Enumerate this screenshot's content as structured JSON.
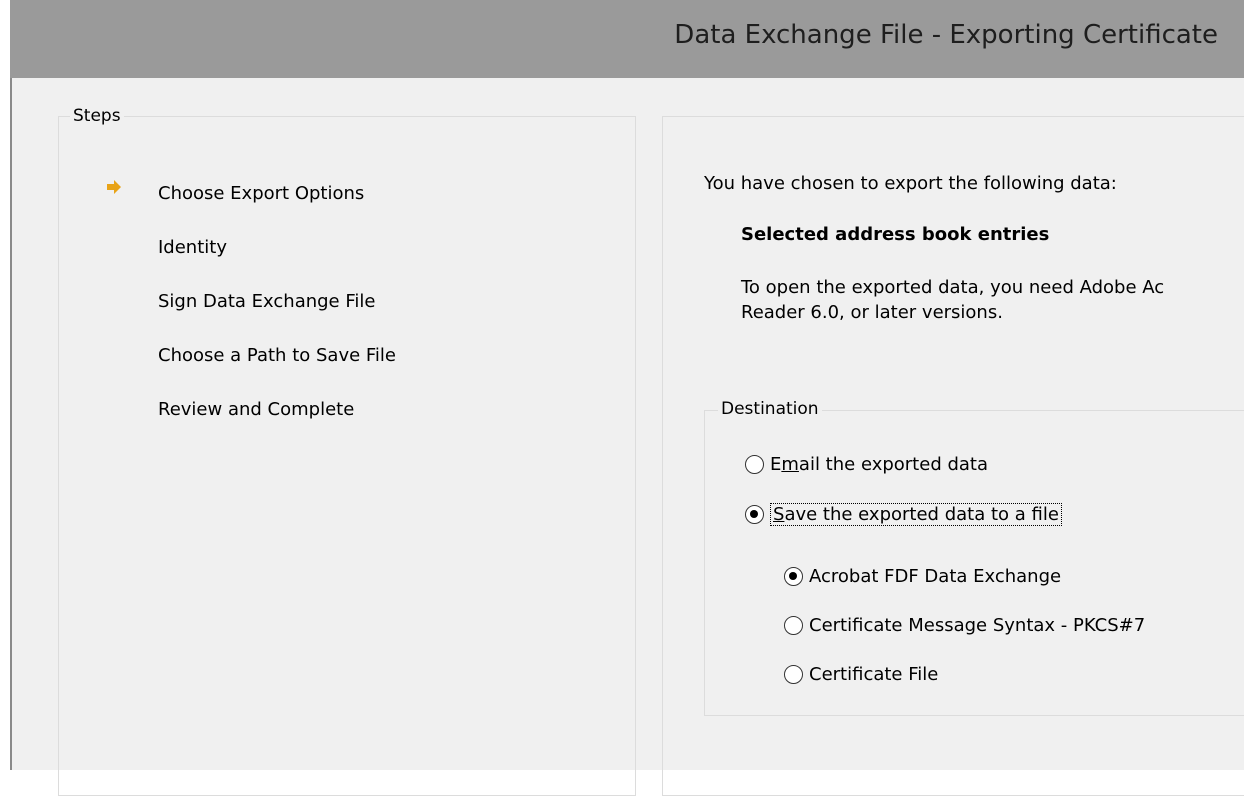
{
  "window": {
    "title": "Data Exchange File - Exporting Certificate"
  },
  "steps": {
    "group_label": "Steps",
    "items": [
      {
        "label": "Choose Export Options",
        "current": true
      },
      {
        "label": "Identity",
        "current": false
      },
      {
        "label": "Sign Data Exchange File",
        "current": false
      },
      {
        "label": "Choose a Path to Save File",
        "current": false
      },
      {
        "label": "Review and Complete",
        "current": false
      }
    ],
    "current_icon": "right-arrow-icon"
  },
  "main": {
    "intro": "You have chosen to export the following data:",
    "selected_data": "Selected address book entries",
    "requirement_line1": "To open the exported data, you need Adobe Ac",
    "requirement_line2": "Reader 6.0, or later versions."
  },
  "destination": {
    "group_label": "Destination",
    "email_option": {
      "prefix": "E",
      "mnemonic": "m",
      "rest": "ail the exported data",
      "selected": false
    },
    "save_option": {
      "mnemonic": "S",
      "rest": "ave the exported data to a file",
      "selected": true
    },
    "formats": [
      {
        "label": "Acrobat FDF Data Exchange",
        "selected": true
      },
      {
        "label": "Certificate Message Syntax - PKCS#7",
        "selected": false
      },
      {
        "label": "Certificate File",
        "selected": false
      }
    ]
  },
  "colors": {
    "titlebar": "#9a9a9a",
    "panel_bg": "#f0f0f0",
    "arrow": "#e8a317"
  }
}
